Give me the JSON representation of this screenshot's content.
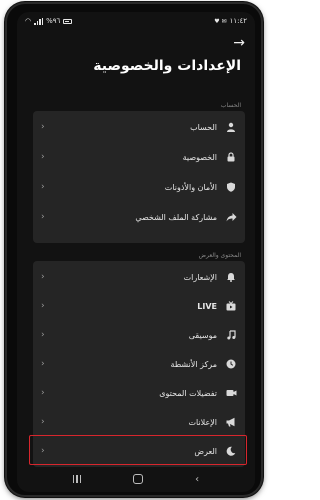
{
  "status_bar": {
    "time": "١١:٤٢",
    "battery": "%٩٦"
  },
  "header": {
    "title": "الإعدادات والخصوصية"
  },
  "sections": [
    {
      "label": "الحساب",
      "items": [
        {
          "label": "الحساب",
          "icon": "person-icon"
        },
        {
          "label": "الخصوصية",
          "icon": "lock-icon"
        },
        {
          "label": "الأمان والأذونات",
          "icon": "shield-icon"
        },
        {
          "label": "مشاركة الملف الشخصي",
          "icon": "share-icon"
        }
      ]
    },
    {
      "label": "المحتوى والعرض",
      "items": [
        {
          "label": "الإشعارات",
          "icon": "bell-icon"
        },
        {
          "label": "LIVE",
          "icon": "live-tv-icon"
        },
        {
          "label": "موسيقى",
          "icon": "music-note-icon"
        },
        {
          "label": "مركز الأنشطة",
          "icon": "clock-icon"
        },
        {
          "label": "تفضيلات المحتوى",
          "icon": "video-camera-icon"
        },
        {
          "label": "الإعلانات",
          "icon": "megaphone-icon"
        },
        {
          "label": "العرض",
          "icon": "moon-icon"
        }
      ]
    }
  ],
  "colors": {
    "background": "#121212",
    "card": "#252525",
    "highlight": "#d7262d"
  }
}
